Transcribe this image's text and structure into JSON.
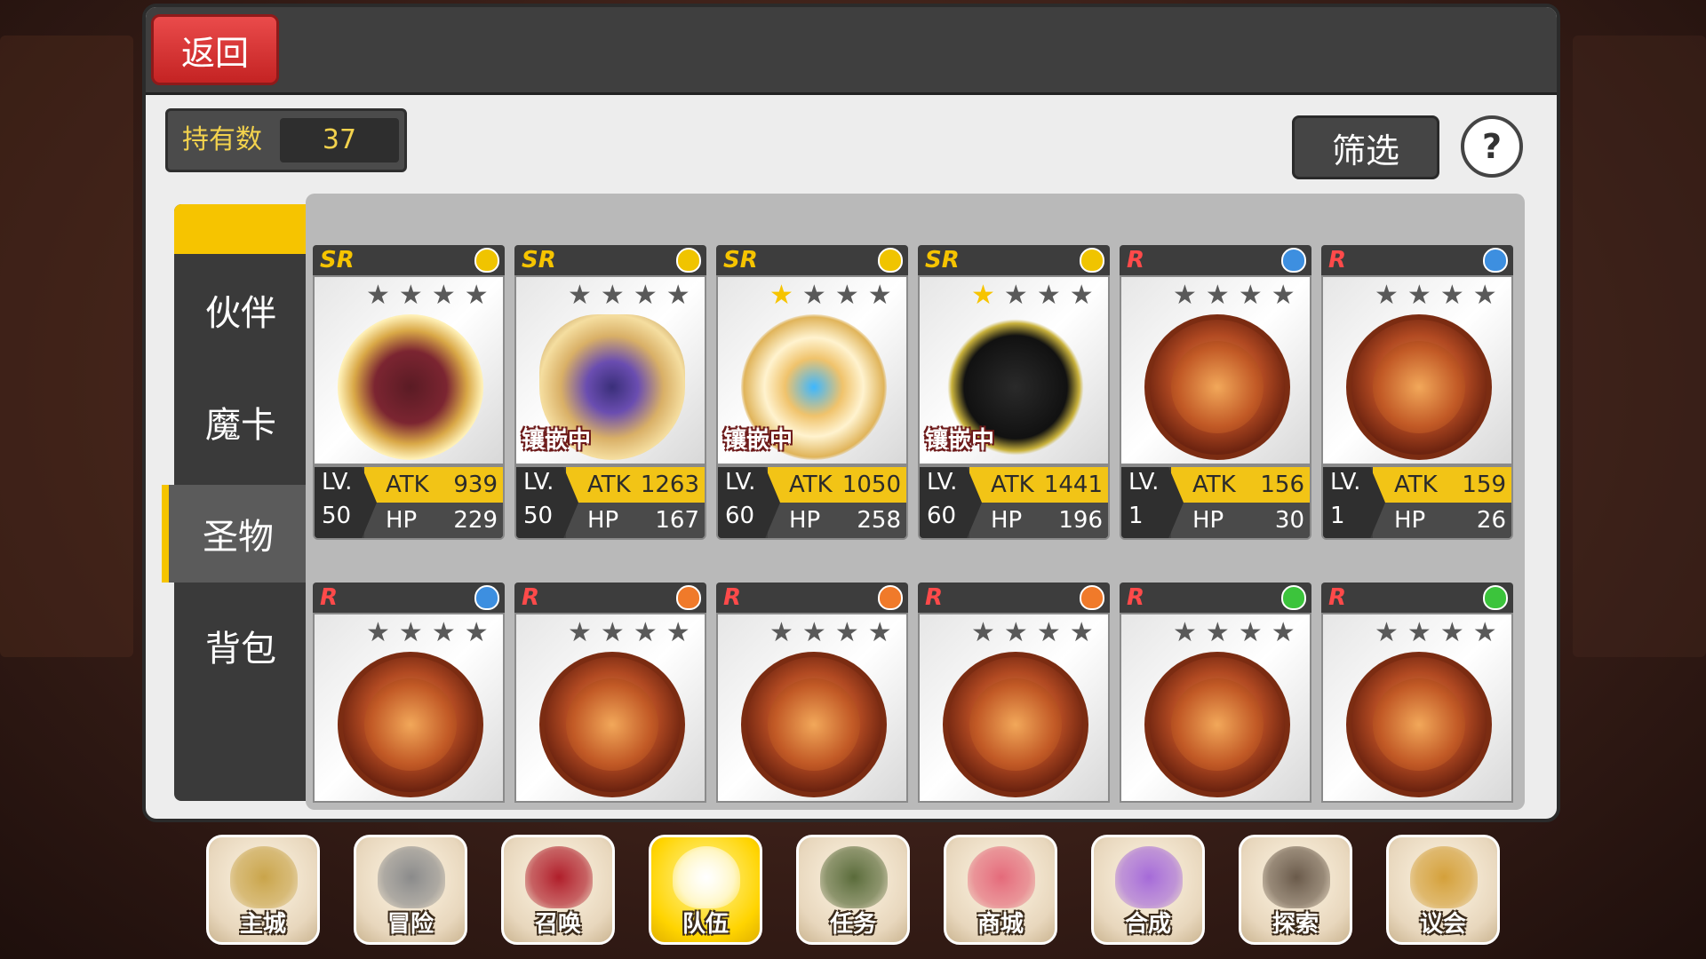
{
  "header": {
    "back_label": "返回"
  },
  "owned": {
    "label": "持有数",
    "count": "37"
  },
  "filter_label": "筛选",
  "help_label": "?",
  "tabs": [
    {
      "label": "伙伴",
      "active": false
    },
    {
      "label": "魔卡",
      "active": false
    },
    {
      "label": "圣物",
      "active": true
    },
    {
      "label": "背包",
      "active": false
    }
  ],
  "cards_row1": [
    {
      "rank": "SR",
      "element_color": "#f0c400",
      "stars": 0,
      "inlay": "",
      "medal": "gold",
      "lv_label": "LV.",
      "lv": "50",
      "atk_label": "ATK",
      "atk": "939",
      "hp_label": "HP",
      "hp": "229"
    },
    {
      "rank": "SR",
      "element_color": "#f0c400",
      "stars": 0,
      "inlay": "镶嵌中",
      "medal": "pharaoh",
      "lv_label": "LV.",
      "lv": "50",
      "atk_label": "ATK",
      "atk": "1263",
      "hp_label": "HP",
      "hp": "167"
    },
    {
      "rank": "SR",
      "element_color": "#f0c400",
      "stars": 1,
      "inlay": "镶嵌中",
      "medal": "wreath",
      "lv_label": "LV.",
      "lv": "60",
      "atk_label": "ATK",
      "atk": "1050",
      "hp_label": "HP",
      "hp": "258"
    },
    {
      "rank": "SR",
      "element_color": "#f0c400",
      "stars": 1,
      "inlay": "镶嵌中",
      "medal": "dark",
      "lv_label": "LV.",
      "lv": "60",
      "atk_label": "ATK",
      "atk": "1441",
      "hp_label": "HP",
      "hp": "196"
    },
    {
      "rank": "R",
      "element_color": "#3d8fe0",
      "stars": 0,
      "inlay": "",
      "medal": "bronze",
      "lv_label": "LV.",
      "lv": "1",
      "atk_label": "ATK",
      "atk": "156",
      "hp_label": "HP",
      "hp": "30"
    },
    {
      "rank": "R",
      "element_color": "#3d8fe0",
      "stars": 0,
      "inlay": "",
      "medal": "bronze",
      "lv_label": "LV.",
      "lv": "1",
      "atk_label": "ATK",
      "atk": "159",
      "hp_label": "HP",
      "hp": "26"
    }
  ],
  "cards_row2": [
    {
      "rank": "R",
      "element_color": "#3d8fe0",
      "stars": 0
    },
    {
      "rank": "R",
      "element_color": "#f07a2a",
      "stars": 0
    },
    {
      "rank": "R",
      "element_color": "#f07a2a",
      "stars": 0
    },
    {
      "rank": "R",
      "element_color": "#f07a2a",
      "stars": 0
    },
    {
      "rank": "R",
      "element_color": "#3cc43c",
      "stars": 0
    },
    {
      "rank": "R",
      "element_color": "#3cc43c",
      "stars": 0
    }
  ],
  "nav": [
    {
      "label": "主城",
      "icon": "crown-icon",
      "active": false
    },
    {
      "label": "冒险",
      "icon": "axe-helmet-icon",
      "active": false
    },
    {
      "label": "召唤",
      "icon": "card-icon",
      "active": false
    },
    {
      "label": "队伍",
      "icon": "winged-shield-icon",
      "active": true
    },
    {
      "label": "任务",
      "icon": "book-icon",
      "active": false
    },
    {
      "label": "商城",
      "icon": "tree-icon",
      "active": false
    },
    {
      "label": "合成",
      "icon": "potion-icon",
      "active": false
    },
    {
      "label": "探索",
      "icon": "shovel-icon",
      "active": false
    },
    {
      "label": "议会",
      "icon": "council-crest-icon",
      "active": false
    }
  ]
}
